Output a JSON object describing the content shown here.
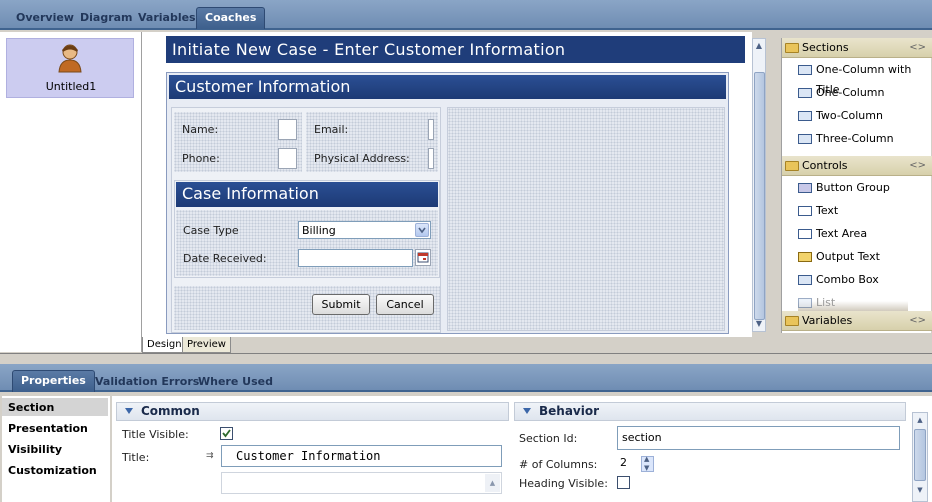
{
  "top_tabs": [
    "Overview",
    "Diagram",
    "Variables",
    "Coaches"
  ],
  "coach": {
    "name": "Untitled1"
  },
  "canvas": {
    "page_title": "Initiate New Case -  Enter Customer Information",
    "customer_section": {
      "title": "Customer Information",
      "fields": {
        "name": "Name:",
        "email": "Email:",
        "phone": "Phone:",
        "address": "Physical Address:"
      }
    },
    "case_section": {
      "title": "Case Information",
      "case_type_label": "Case Type",
      "case_type_value": "Billing",
      "date_label": "Date Received:"
    },
    "buttons": {
      "submit": "Submit",
      "cancel": "Cancel"
    }
  },
  "design_tabs": [
    "Design",
    "Preview"
  ],
  "palette": {
    "sections_title": "Sections",
    "sections": [
      "One-Column with Title",
      "One-Column",
      "Two-Column",
      "Three-Column"
    ],
    "controls_title": "Controls",
    "controls": [
      "Button Group",
      "Text",
      "Text Area",
      "Output Text",
      "Combo Box",
      "List"
    ],
    "variables_title": "Variables"
  },
  "bottom_tabs": [
    "Properties",
    "Validation Errors",
    "Where Used"
  ],
  "prop_nav": [
    "Section",
    "Presentation",
    "Visibility",
    "Customization"
  ],
  "common": {
    "title": "Common",
    "title_visible_label": "Title Visible:",
    "title_visible": true,
    "title_label": "Title:",
    "title_value": "Customer Information"
  },
  "behavior": {
    "title": "Behavior",
    "section_id_label": "Section Id:",
    "section_id_value": "section",
    "columns_label": "# of Columns:",
    "columns_value": "2",
    "heading_visible_label": "Heading Visible:",
    "heading_visible": false
  },
  "colors": {
    "header_blue": "#1f3d7a",
    "tab_blue": "#3d5f8c"
  }
}
